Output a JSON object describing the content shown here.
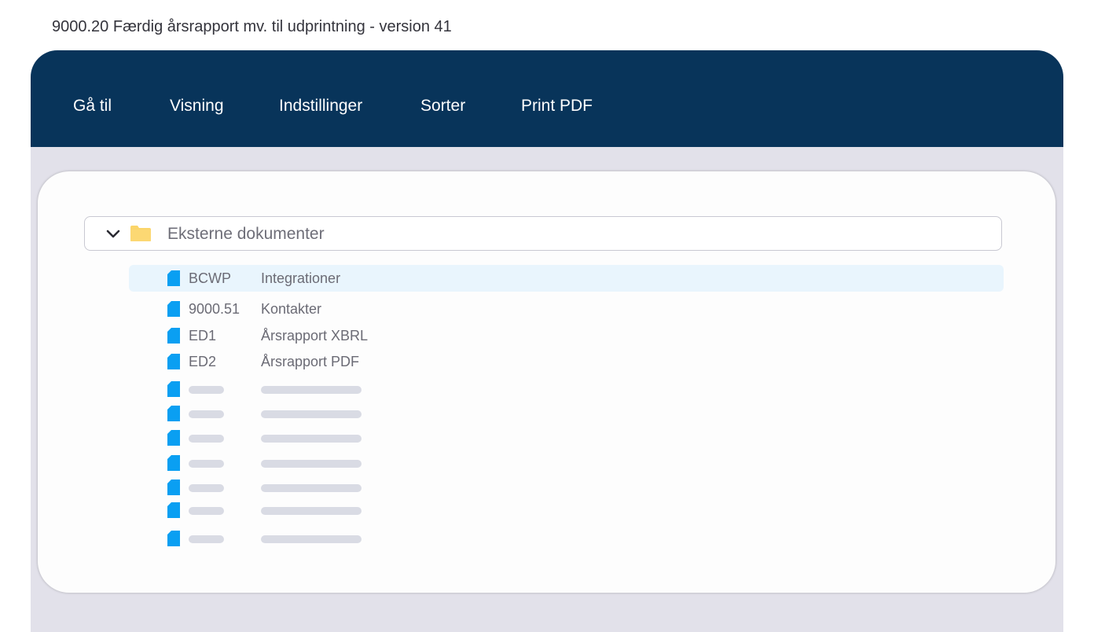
{
  "page": {
    "title": "9000.20 Færdig årsrapport mv. til udprintning - version 41"
  },
  "menubar": {
    "items": [
      {
        "label": "Gå til"
      },
      {
        "label": "Visning"
      },
      {
        "label": "Indstillinger"
      },
      {
        "label": "Sorter"
      },
      {
        "label": "Print PDF"
      }
    ]
  },
  "tree": {
    "folder": {
      "label": "Eksterne dokumenter",
      "expanded": true,
      "icon": "folder-icon"
    },
    "documents": [
      {
        "code": "BCWP",
        "name": "Integrationer",
        "selected": true
      },
      {
        "code": "9000.51",
        "name": "Kontakter"
      },
      {
        "code": "ED1",
        "name": "Årsrapport XBRL"
      },
      {
        "code": "ED2",
        "name": "Årsrapport PDF"
      }
    ],
    "placeholder_rows": 7
  },
  "colors": {
    "menubar": "#08345a",
    "doc_icon": "#0a9ff2",
    "folder_icon": "#fbd56a",
    "selected_row": "#e9f5fd",
    "frame": "#e2e1ea"
  }
}
